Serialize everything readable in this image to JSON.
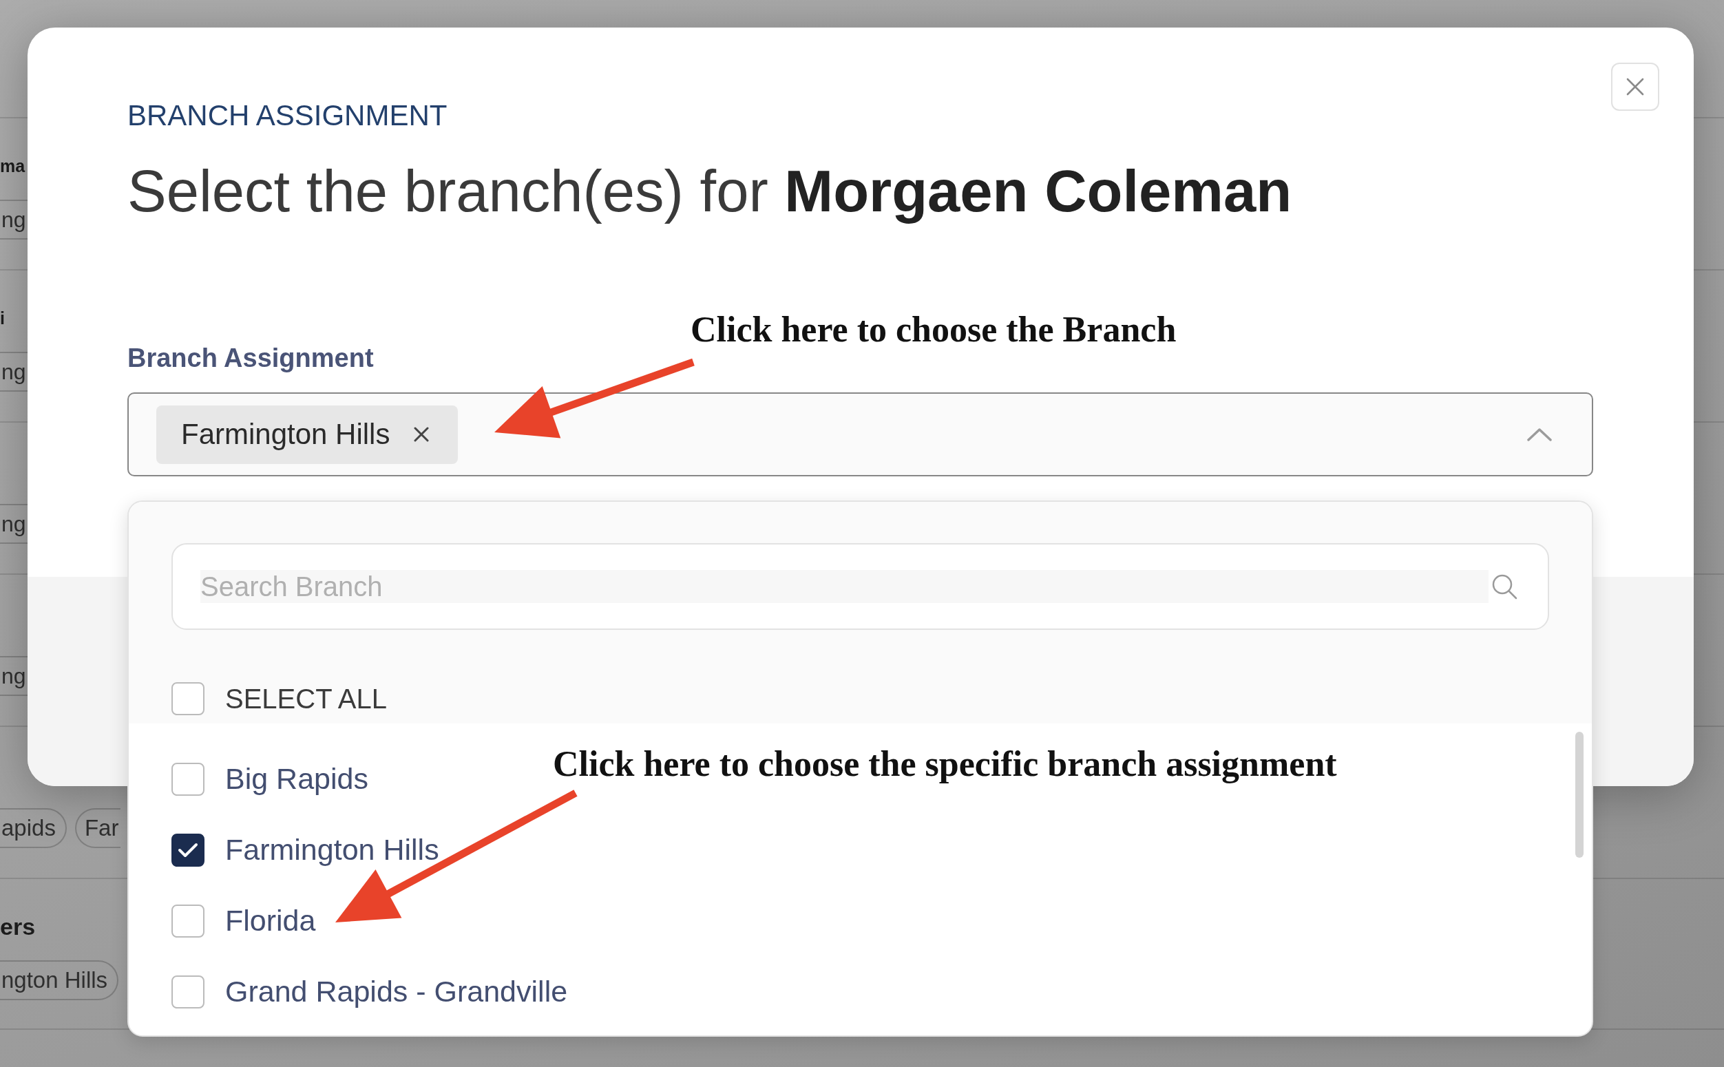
{
  "background_list": {
    "rows": [
      {
        "title": "ma",
        "tags": [
          "ng"
        ]
      },
      {
        "title": "i",
        "tags": [
          "ng"
        ]
      },
      {
        "tags": [
          "ng"
        ]
      },
      {
        "tags": [
          "ng"
        ]
      },
      {
        "tags": [
          "apids",
          "Far"
        ]
      },
      {
        "title": "ers",
        "tags": [
          "ngton Hills"
        ]
      }
    ]
  },
  "modal": {
    "eyebrow": "BRANCH ASSIGNMENT",
    "title": "Select the branch(es) for **Morgaen Coleman**",
    "field": {
      "label": "Branch Assignment",
      "chips": [
        "Farmington Hills"
      ],
      "expanded": true
    },
    "dropdown": {
      "search": {
        "placeholder": "Search Branch"
      },
      "select_all": {
        "label": "SELECT ALL",
        "checked": false
      },
      "options": [
        {
          "label": "Big Rapids",
          "checked": false
        },
        {
          "label": "Farmington Hills",
          "checked": true
        },
        {
          "label": "Florida",
          "checked": false
        },
        {
          "label": "Grand Rapids - Grandville",
          "checked": false
        }
      ]
    }
  },
  "annotations": [
    {
      "text": "Click here to choose the Branch"
    },
    {
      "text": "Click here to choose the specific branch assignment"
    }
  ]
}
